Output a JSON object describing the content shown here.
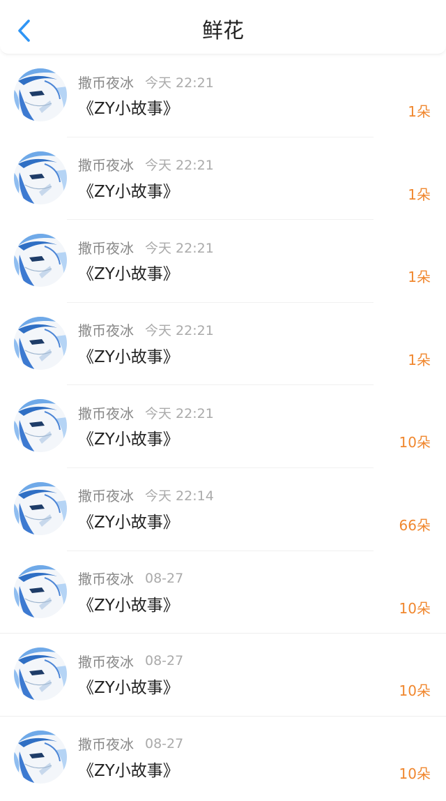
{
  "header": {
    "title": "鲜花",
    "back_icon": "chevron-left-icon",
    "accent_color": "#2f95f5"
  },
  "count_color": "#f0872e",
  "items": [
    {
      "sender": "撒币夜冰",
      "time": "今天 22:21",
      "title": "《ZY小故事》",
      "count": "1朵"
    },
    {
      "sender": "撒币夜冰",
      "time": "今天 22:21",
      "title": "《ZY小故事》",
      "count": "1朵"
    },
    {
      "sender": "撒币夜冰",
      "time": "今天 22:21",
      "title": "《ZY小故事》",
      "count": "1朵"
    },
    {
      "sender": "撒币夜冰",
      "time": "今天 22:21",
      "title": "《ZY小故事》",
      "count": "1朵"
    },
    {
      "sender": "撒币夜冰",
      "time": "今天 22:21",
      "title": "《ZY小故事》",
      "count": "10朵"
    },
    {
      "sender": "撒币夜冰",
      "time": "今天 22:14",
      "title": "《ZY小故事》",
      "count": "66朵"
    },
    {
      "sender": "撒币夜冰",
      "time": "08-27",
      "title": "《ZY小故事》",
      "count": "10朵"
    },
    {
      "sender": "撒币夜冰",
      "time": "08-27",
      "title": "《ZY小故事》",
      "count": "10朵"
    },
    {
      "sender": "撒币夜冰",
      "time": "08-27",
      "title": "《ZY小故事》",
      "count": "10朵"
    }
  ]
}
